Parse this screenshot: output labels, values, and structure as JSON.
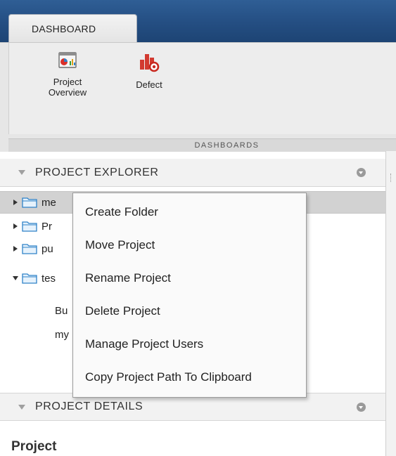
{
  "toolstrip": {
    "tab_label": "DASHBOARD",
    "buttons": [
      {
        "label_line1": "Project",
        "label_line2": "Overview",
        "icon": "project-overview-icon"
      },
      {
        "label_line1": "Defect",
        "label_line2": "",
        "icon": "defect-icon"
      }
    ],
    "section_label": "DASHBOARDS"
  },
  "explorer": {
    "title": "PROJECT EXPLORER",
    "tree": [
      {
        "label": "me",
        "expanded": false,
        "selected": true
      },
      {
        "label": "Pr",
        "expanded": false,
        "selected": false
      },
      {
        "label": "pu",
        "expanded": false,
        "selected": false
      },
      {
        "label": "tes",
        "expanded": true,
        "selected": false,
        "children": [
          "Bu",
          "my"
        ]
      }
    ]
  },
  "context_menu": {
    "items": [
      "Create Folder",
      "Move Project",
      "Rename Project",
      "Delete Project",
      "Manage Project Users",
      "Copy Project Path To Clipboard"
    ]
  },
  "details": {
    "title": "PROJECT DETAILS",
    "project_label": "Project"
  },
  "colors": {
    "title_band": "#244e82",
    "selection": "#d2d2d2",
    "folder_blue": "#2f82c8"
  }
}
